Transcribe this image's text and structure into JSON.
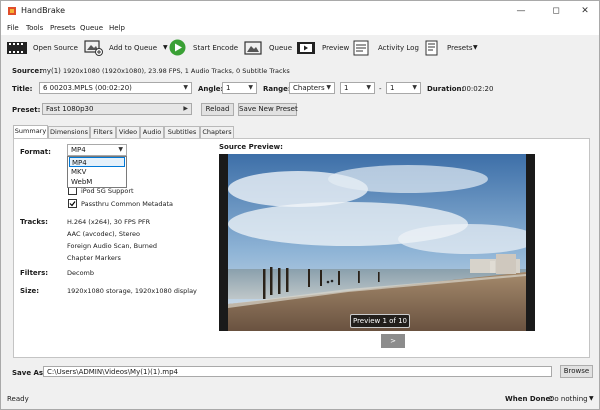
{
  "window": {
    "title": "HandBrake"
  },
  "menu": [
    "File",
    "Tools",
    "Presets",
    "Queue",
    "Help"
  ],
  "toolbar": {
    "open_source": "Open Source",
    "add_to_queue": "Add to Queue",
    "start_encode": "Start Encode",
    "queue": "Queue",
    "preview": "Preview",
    "activity_log": "Activity Log",
    "presets": "Presets"
  },
  "source": {
    "label": "Source:",
    "name": "my(1)",
    "info": "1920x1080 (1920x1080), 23.98 FPS, 1 Audio Tracks, 0 Subtitle Tracks"
  },
  "title_row": {
    "title_label": "Title:",
    "title_value": "6 00203.MPLS (00:02:20)",
    "angle_label": "Angle:",
    "angle_value": "1",
    "range_label": "Range:",
    "range_type": "Chapters",
    "range_start": "1",
    "range_sep": "-",
    "range_end": "1",
    "duration_label": "Duration:",
    "duration_value": "00:02:20"
  },
  "preset": {
    "label": "Preset:",
    "value": "Fast 1080p30",
    "reload": "Reload",
    "save_new": "Save New Preset"
  },
  "tabs": [
    "Summary",
    "Dimensions",
    "Filters",
    "Video",
    "Audio",
    "Subtitles",
    "Chapters"
  ],
  "summary": {
    "format_label": "Format:",
    "format_value": "MP4",
    "format_options": [
      "MP4",
      "MKV",
      "WebM"
    ],
    "ipod_support": "iPod 5G Support",
    "passthru_metadata": "Passthru Common Metadata",
    "tracks_label": "Tracks:",
    "tracks": [
      "H.264 (x264), 30 FPS PFR",
      "AAC (avcodec), Stereo",
      "Foreign Audio Scan, Burned",
      "Chapter Markers"
    ],
    "filters_label": "Filters:",
    "filters_value": "Decomb",
    "size_label": "Size:",
    "size_value": "1920x1080 storage, 1920x1080 display",
    "source_preview_label": "Source Preview:",
    "preview_badge": "Preview 1 of 10",
    "next_button": ">"
  },
  "save_as": {
    "label": "Save As:",
    "path": "C:\\Users\\ADMIN\\Videos\\My(1)(1).mp4",
    "browse": "Browse"
  },
  "status": {
    "text": "Ready",
    "when_done_label": "When Done:",
    "when_done_value": "Do nothing"
  },
  "colors": {
    "accent": "#0078d7",
    "play_green": "#3aa035"
  }
}
